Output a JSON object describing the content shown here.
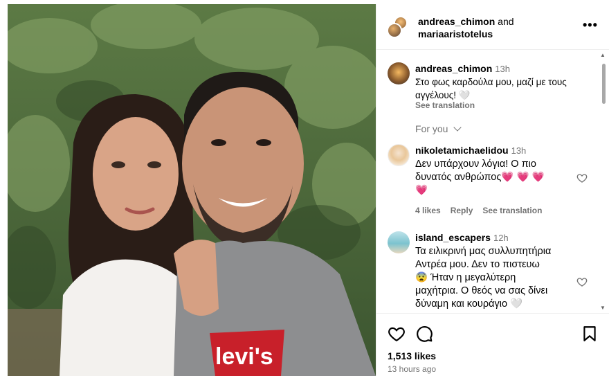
{
  "header": {
    "user1": "andreas_chimon",
    "joiner": " and",
    "user2": "mariaaristotelus",
    "more_label": "•••"
  },
  "caption": {
    "username": "andreas_chimon",
    "time": "13h",
    "text_line1": "Στο φως καρδούλα μου, μαζί με τους",
    "text_line2": "αγγέλους! 🤍",
    "see_translation": "See translation"
  },
  "for_you": {
    "label": "For you",
    "icon": "chevron-down-icon"
  },
  "comments": [
    {
      "username": "nikoletamichaelidou",
      "time": "13h",
      "line1": "Δεν υπάρχουν λόγια! Ο πιο",
      "line2": "δυνατός ανθρώπος",
      "hearts": "💗 💗 💗",
      "line3": "💗",
      "likes": "4 likes",
      "reply": "Reply",
      "see_translation": "See translation"
    },
    {
      "username": "island_escapers",
      "time": "12h",
      "line1": "Τα ειλικρινή μας συλλυπητήρια",
      "line2": "Αντρέα μου. Δεν το πιστευω",
      "line3": "😨 Ήταν η μεγαλύτερη",
      "line4": "μαχήτρια. Ο θεός να σας δίνει",
      "line5": "δύναμη και κουράγιο 🤍"
    }
  ],
  "footer": {
    "likes": "1,513 likes",
    "time_ago": "13 hours ago"
  },
  "colors": {
    "accent_heart": "#ed1d50",
    "muted": "#737373",
    "border": "#efefef"
  }
}
